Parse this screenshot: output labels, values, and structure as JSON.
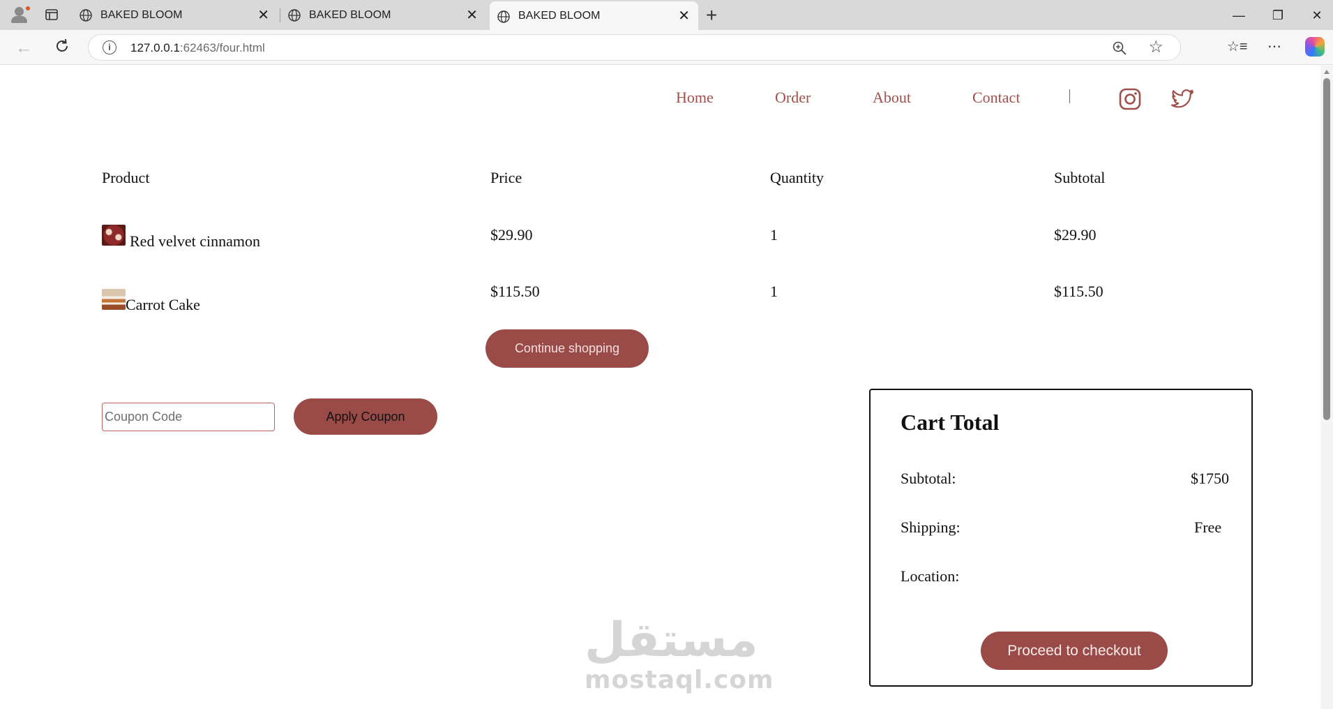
{
  "browser": {
    "tabs": [
      {
        "title": "BAKED BLOOM",
        "close": "✕"
      },
      {
        "title": "BAKED BLOOM",
        "close": "✕"
      },
      {
        "title": "BAKED BLOOM",
        "close": "✕"
      }
    ],
    "new_tab": "+",
    "window": {
      "minimize": "—",
      "restore": "❐",
      "close": "✕"
    },
    "address": {
      "host": "127.0.0.1",
      "rest": ":62463/four.html"
    },
    "tools": {
      "favorites": "☆≡",
      "more": "⋯"
    }
  },
  "site": {
    "nav": [
      "Home",
      "Order",
      "About",
      "Contact"
    ],
    "accent_color": "#a0504a",
    "social": [
      "instagram-icon",
      "twitter-icon"
    ]
  },
  "cart": {
    "headers": [
      "Product",
      "Price",
      "Quantity",
      "Subtotal"
    ],
    "rows": [
      {
        "product": "Red velvet cinnamon",
        "price": "$29.90",
        "quantity": "1",
        "subtotal": "$29.90"
      },
      {
        "product": "Carrot Cake",
        "price": "$115.50",
        "quantity": "1",
        "subtotal": "$115.50"
      }
    ],
    "continue_label": "Continue shopping",
    "coupon_placeholder": "Coupon Code",
    "apply_label": "Apply Coupon",
    "button_color": "#9a4b47"
  },
  "totals": {
    "title": "Cart Total",
    "subtotal_label": "Subtotal:",
    "subtotal_value": "$1750",
    "shipping_label": "Shipping:",
    "shipping_value": "Free",
    "location_label": "Location:",
    "checkout_label": "Proceed to checkout"
  },
  "watermark": {
    "arabic": "مستقل",
    "latin": "mostaql.com"
  }
}
